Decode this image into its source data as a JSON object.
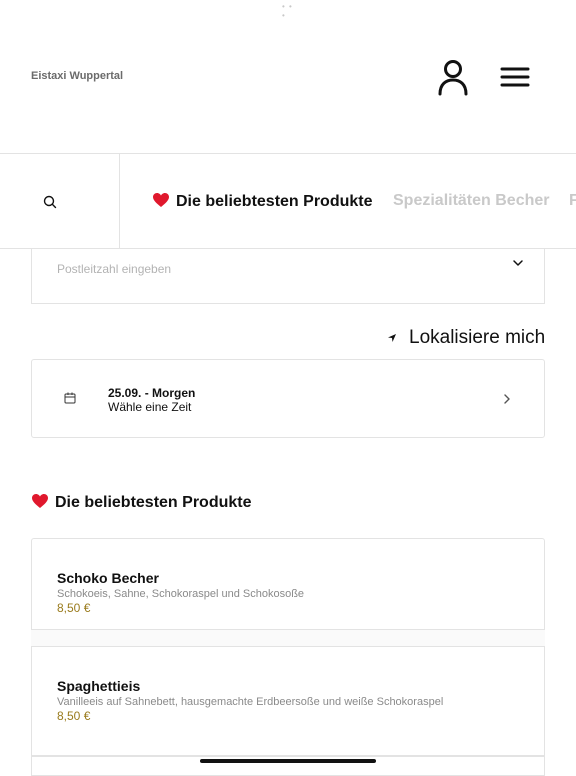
{
  "header": {
    "shop_name": "Eistaxi Wuppertal",
    "user_icon": "user-icon",
    "menu_icon": "hamburger-menu-icon"
  },
  "categories": {
    "search_icon": "search-icon",
    "tabs": [
      {
        "label": "Die beliebtesten Produkte",
        "active": true,
        "emoji": "heart"
      },
      {
        "label": "Spezialitäten Becher",
        "active": false
      },
      {
        "label": "F",
        "active": false
      }
    ]
  },
  "postcode": {
    "placeholder": "Postleitzahl eingeben"
  },
  "localize": {
    "label": "Lokalisiere mich"
  },
  "delivery_time": {
    "date": "25.09. - Morgen",
    "prompt": "Wähle eine Zeit"
  },
  "section": {
    "title": "Die beliebtesten Produkte"
  },
  "products": [
    {
      "name": "Schoko Becher",
      "description": "Schokoeis, Sahne, Schokoraspel und Schokosoße",
      "price": "8,50 €"
    },
    {
      "name": "Spaghettieis",
      "description": "Vanilleeis auf Sahnebett, hausgemachte Erdbeersoße und weiße Schokoraspel",
      "price": "8,50 €"
    }
  ],
  "colors": {
    "price": "#9a7b1d",
    "heart": "#e0182d",
    "muted_tab": "#c9c9c9",
    "border": "#e3e3e3"
  }
}
